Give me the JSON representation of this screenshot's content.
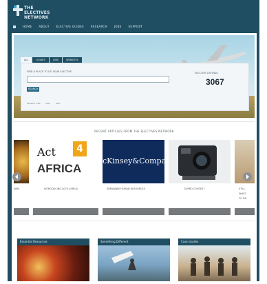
{
  "header": {
    "logo_line1": "THE",
    "logo_line2": "ELECTIVES",
    "logo_line3": "NETWORK",
    "nav": [
      "HOME",
      "ABOUT",
      "ELECTIVE GUIDES",
      "RESEARCH",
      "JOBS",
      "SUPPORT"
    ]
  },
  "search": {
    "tabs": [
      "ALL",
      "GUIDES",
      "JOBS",
      "WEBSITES"
    ],
    "label": "FIND A PLACE TO DO YOUR ELECTIVE",
    "button": "SEARCH",
    "footer": [
      "SEARCH TIPS",
      "MAP",
      "ADD"
    ],
    "stats_label": "ELECTIVE LISTINGS",
    "stats_value": "3067"
  },
  "featured": {
    "title": "RECENT ARTICLES FROM THE ELECTIVES NETWORK",
    "cards": [
      {
        "caption": "ANN",
        "bg": "#c79a3b"
      },
      {
        "caption": "INTRODUCING ACT4 AFRICA",
        "logo_text_act": "Act",
        "logo_text_4": "4",
        "logo_text_africa": "AFRICA",
        "bg": "#ffffff"
      },
      {
        "caption": "ZIMBABWE HUMAN RESOURCES",
        "logo_text": "cKinsey&Compan",
        "bg": "#0f2b5c"
      },
      {
        "caption": "GOPRO CONTEST",
        "bg": "#2a2d31"
      },
      {
        "caption": "STILL",
        "caption2": "WHAT",
        "caption3": "TO DO",
        "bg": "#c6b08f"
      }
    ]
  },
  "tiles": [
    {
      "title": "Essential Resources",
      "bg": "#7a2a18"
    },
    {
      "title": "Something Different",
      "bg": "#6f98b8"
    },
    {
      "title": "Case studies",
      "bg": "#c8b08d"
    }
  ],
  "colors": {
    "brand": "#1f4e62",
    "accent": "#2f6d8a",
    "bar": "#75797c"
  }
}
